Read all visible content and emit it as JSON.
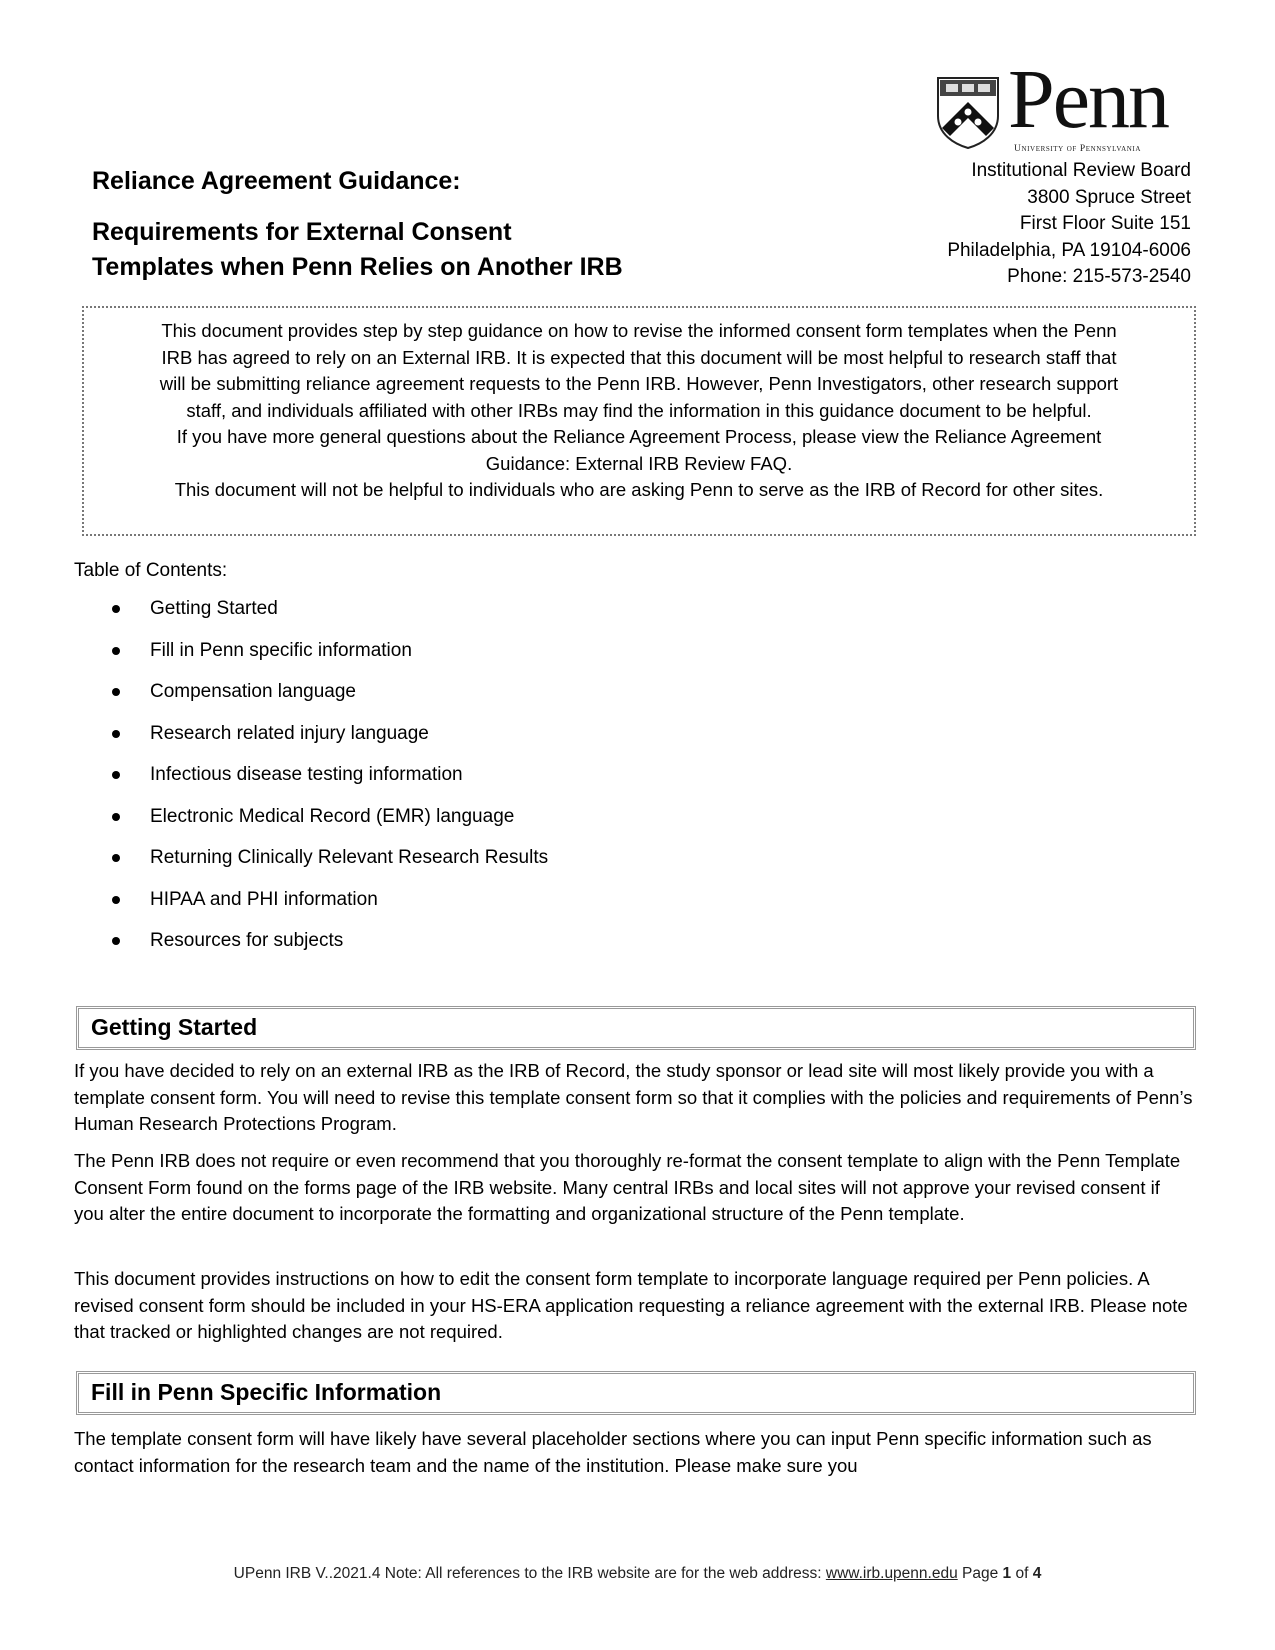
{
  "header": {
    "logo": {
      "wordmark": "Penn",
      "subtitle": "University of Pennsylvania",
      "shield_icon": "penn-shield-icon"
    },
    "address_lines": [
      "Institutional Review Board",
      "3800 Spruce Street",
      "First Floor Suite 151",
      "Philadelphia, PA 19104-6006",
      "Phone: 215-573-2540"
    ],
    "title_line1": "Reliance Agreement Guidance:",
    "title_line2": "Requirements for External Consent",
    "title_line3": "Templates when Penn Relies on Another IRB"
  },
  "intro": {
    "lines": [
      "This document provides step by step guidance on how to revise the informed consent form templates when the Penn",
      "IRB has agreed to rely on an External IRB. It is expected that this document will be most helpful to research staff that",
      "will be submitting reliance agreement requests to the Penn IRB. However, Penn Investigators, other research support",
      "staff, and individuals affiliated with other IRBs may find the information in this guidance document to be helpful.",
      "If you have more general questions about the Reliance Agreement Process, please view the Reliance Agreement",
      "Guidance: External IRB Review FAQ.",
      "This document will not be helpful to individuals who are asking Penn to serve as the IRB of Record for other sites."
    ]
  },
  "toc": {
    "label": "Table of Contents:",
    "items": [
      "Getting Started",
      "Fill in Penn specific information",
      "Compensation language",
      "Research related injury language",
      "Infectious disease testing information",
      "Electronic Medical Record (EMR) language",
      "Returning Clinically Relevant Research Results",
      "HIPAA and PHI information",
      "Resources for subjects"
    ]
  },
  "sections": [
    {
      "heading": "Getting Started",
      "paragraphs": [
        "If you have decided to rely on an external IRB as the IRB of Record, the study sponsor or lead site will most likely provide you with a template consent form. You will need to revise this template consent form so that it complies with the policies and requirements of Penn’s Human Research Protections Program.",
        "The Penn IRB does not require or even recommend that you thoroughly re-format the consent template to align with the Penn Template Consent Form found on the forms page of the IRB website. Many central IRBs and local sites will not approve your revised consent if you alter the entire document to incorporate the formatting and organizational structure of the Penn template.",
        "This document provides instructions on how to edit the consent form template to incorporate language required per Penn policies. A revised consent form should be included in your HS-ERA application requesting a reliance agreement with the external IRB. Please note that tracked or highlighted changes are not required."
      ]
    },
    {
      "heading": "Fill in Penn Specific Information",
      "paragraphs": [
        "The template consent form will have likely have several placeholder sections where you can input Penn specific information such as contact information for the research team and the name of the institution. Please make sure you"
      ]
    }
  ],
  "footer": {
    "prefix": "UPenn IRB V..2021.4 Note: All references to the IRB website are for the web address: ",
    "link_text": "www.irb.upenn.edu",
    "page_word": " Page ",
    "page_current": "1",
    "of_word": " of ",
    "page_total": "4"
  }
}
